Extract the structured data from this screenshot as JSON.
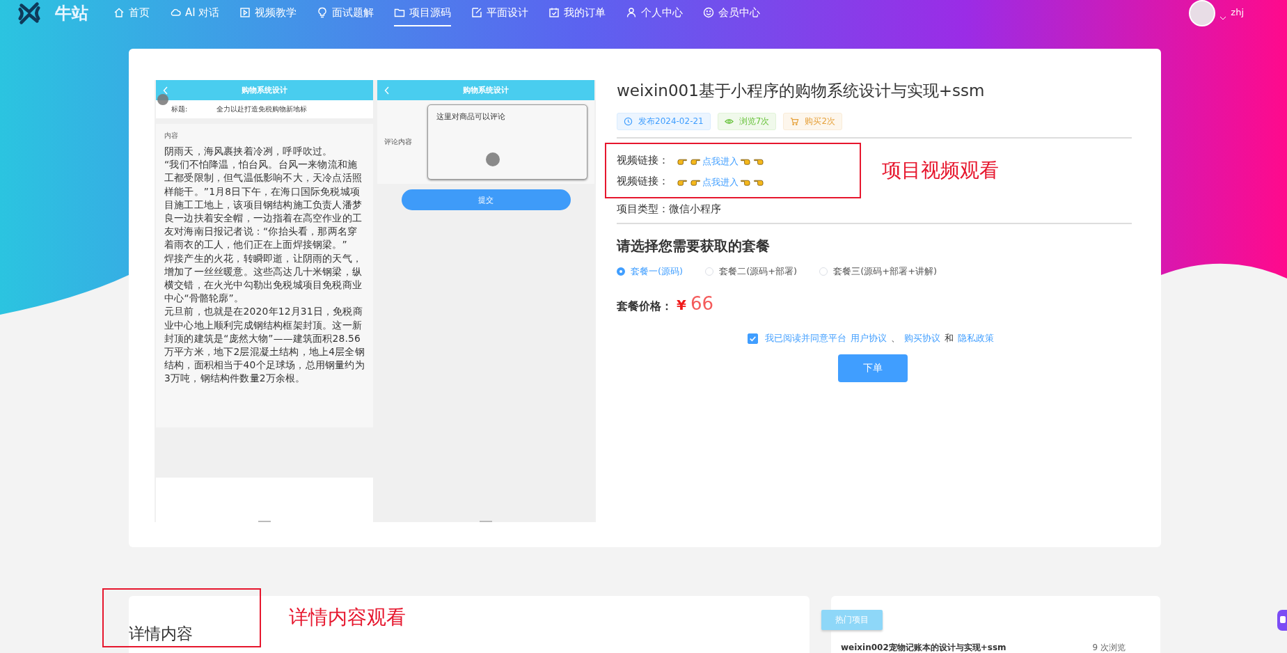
{
  "nav": {
    "logo_text": "牛站",
    "items": [
      {
        "label": "首页",
        "selected": false
      },
      {
        "label": "AI 对话",
        "selected": false
      },
      {
        "label": "视频教学",
        "selected": false
      },
      {
        "label": "面试题解",
        "selected": false
      },
      {
        "label": "项目源码",
        "selected": true
      },
      {
        "label": "平面设计",
        "selected": false
      },
      {
        "label": "我的订单",
        "selected": false
      },
      {
        "label": "个人中心",
        "selected": false
      },
      {
        "label": "会员中心",
        "selected": false
      }
    ],
    "user": "zhj"
  },
  "preview": {
    "screens": [
      {
        "kind": "article",
        "header": "购物系统设计",
        "title_label": "标题:",
        "title_value": "全力以赴打造免税购物新地标",
        "content_label": "内容",
        "paragraphs": [
          "阴雨天，海风裹挟着冷冽，呼呼吹过。",
          "“我们不怕降温，怕台风。台风一来物流和施工都受限制，但气温低影响不大，天冷点活照样能干。”1月8日下午，在海口国际免税城项目施工工地上，该项目钢结构施工负责人潘梦良一边扶着安全帽，一边指着在高空作业的工友对海南日报记者说：“你抬头看，那两名穿着雨衣的工人，他们正在上面焊接钢梁。”",
          "焊接产生的火花，转瞬即逝，让阴雨的天气，增加了一丝丝暖意。这些高达几十米钢梁，纵横交错，在火光中勾勒出免税城项目免税商业中心“骨骼轮廓”。",
          "元旦前，也就是在2020年12月31日，免税商业中心地上顺利完成钢结构框架封顶。这一新封顶的建筑是“庞然大物”——建筑面积28.56万平方米，地下2层混凝土结构，地上4层全钢结构，面积相当于40个足球场，总用钢量约为3万吨，钢结构件数量2万余根。"
        ]
      },
      {
        "kind": "comment",
        "header": "购物系统设计",
        "field_label": "评论内容",
        "field_value": "这里对商品可以评论",
        "button": "提交"
      }
    ]
  },
  "product": {
    "title": "weixin001基于小程序的购物系统设计与实现+ssm",
    "tags": [
      {
        "kind": "date",
        "text": "发布2024-02-21"
      },
      {
        "kind": "views",
        "text": "浏览7次"
      },
      {
        "kind": "buys",
        "text": "购买2次"
      }
    ],
    "video_links": [
      {
        "label": "视频链接：",
        "link": "点我进入"
      },
      {
        "label": "视频链接：",
        "link": "点我进入"
      }
    ],
    "annotation": "项目视频观看",
    "type_label": "项目类型：",
    "type_value": "微信小程序",
    "package_heading": "请选择您需要获取的套餐",
    "packages": [
      {
        "label": "套餐一(源码)",
        "selected": true
      },
      {
        "label": "套餐二(源码+部署)",
        "selected": false
      },
      {
        "label": "套餐三(源码+部署+讲解)",
        "selected": false
      }
    ],
    "price_label": "套餐价格：",
    "currency": "¥",
    "price": "66",
    "agreement": {
      "checked": true,
      "text": "我已阅读并同意平台",
      "link1": "用户协议",
      "sep": "、",
      "link2": "购买协议",
      "and": "和",
      "link3": "隐私政策"
    },
    "order_button": "下单"
  },
  "details": {
    "title": "详情内容",
    "annotation": "详情内容观看"
  },
  "hot": {
    "badge": "热门项目",
    "item_title": "weixin002宠物记账本的设计与实现+ssm",
    "item_views": "9 次浏览"
  }
}
